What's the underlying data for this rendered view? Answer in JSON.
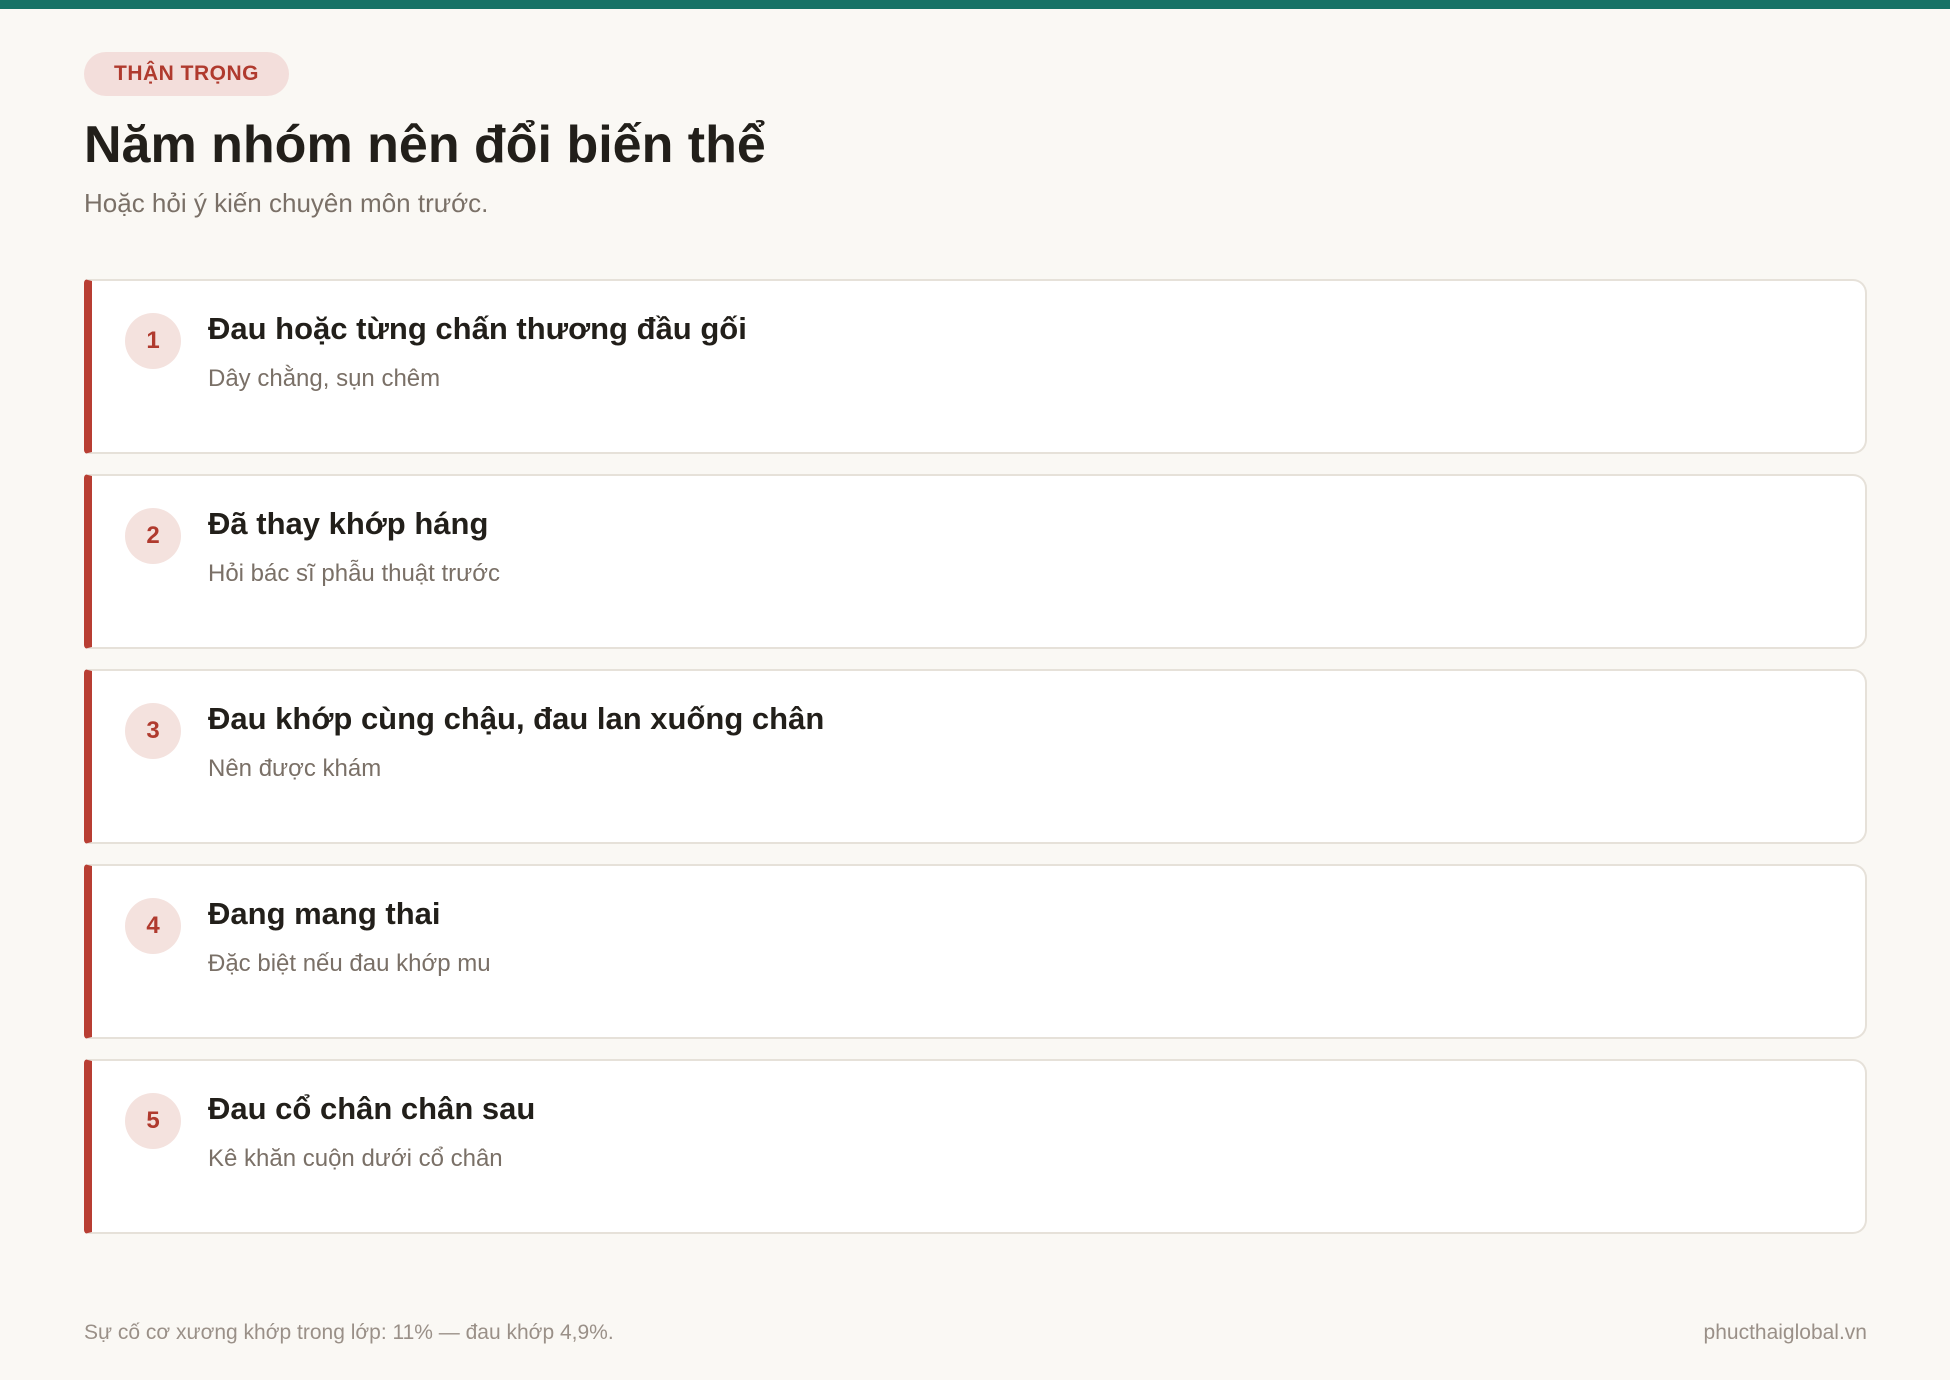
{
  "badge": "THẬN TRỌNG",
  "title": "Năm nhóm nên đổi biến thể",
  "subtitle": "Hoặc hỏi ý kiến chuyên môn trước.",
  "items": [
    {
      "number": "1",
      "title": "Đau hoặc từng chấn thương đầu gối",
      "description": "Dây chằng, sụn chêm"
    },
    {
      "number": "2",
      "title": "Đã thay khớp háng",
      "description": "Hỏi bác sĩ phẫu thuật trước"
    },
    {
      "number": "3",
      "title": "Đau khớp cùng chậu, đau lan xuống chân",
      "description": "Nên được khám"
    },
    {
      "number": "4",
      "title": "Đang mang thai",
      "description": "Đặc biệt nếu đau khớp mu"
    },
    {
      "number": "5",
      "title": "Đau cổ chân chân sau",
      "description": "Kê khăn cuộn dưới cổ chân"
    }
  ],
  "footer": {
    "note": "Sự cố cơ xương khớp trong lớp: 11% — đau khớp 4,9%.",
    "domain": "phucthaiglobal.vn"
  },
  "colors": {
    "accent_top": "#177266",
    "accent_red": "#b83e33",
    "badge_bg": "#f3dedb",
    "background": "#faf8f4"
  }
}
